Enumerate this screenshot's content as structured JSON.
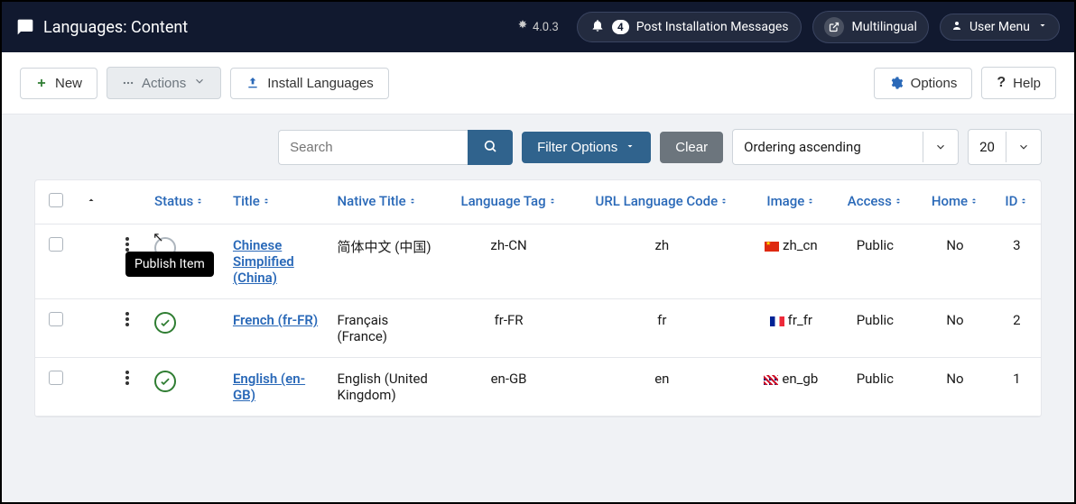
{
  "topbar": {
    "title": "Languages: Content",
    "version": "4.0.3",
    "notif_count": "4",
    "notif_label": "Post Installation Messages",
    "multilingual_label": "Multilingual",
    "user_menu_label": "User Menu"
  },
  "toolbar": {
    "new_label": "New",
    "actions_label": "Actions",
    "install_label": "Install Languages",
    "options_label": "Options",
    "help_label": "Help"
  },
  "filters": {
    "search_placeholder": "Search",
    "filter_options_label": "Filter Options",
    "clear_label": "Clear",
    "ordering_label": "Ordering ascending",
    "page_size": "20"
  },
  "table": {
    "columns": {
      "status": "Status",
      "title": "Title",
      "native_title": "Native Title",
      "language_tag": "Language Tag",
      "url_code": "URL Language Code",
      "image": "Image",
      "access": "Access",
      "home": "Home",
      "id": "ID"
    },
    "rows": [
      {
        "status": "unpublished",
        "title": "Chinese Simplified (China)",
        "native": "简体中文 (中国)",
        "tag": "zh-CN",
        "url": "zh",
        "image": "zh_cn",
        "flag": "cn",
        "access": "Public",
        "home": "No",
        "id": "3"
      },
      {
        "status": "published",
        "title": "French (fr-FR)",
        "native": "Français (France)",
        "tag": "fr-FR",
        "url": "fr",
        "image": "fr_fr",
        "flag": "fr",
        "access": "Public",
        "home": "No",
        "id": "2"
      },
      {
        "status": "published",
        "title": "English (en-GB)",
        "native": "English (United Kingdom)",
        "tag": "en-GB",
        "url": "en",
        "image": "en_gb",
        "flag": "gb",
        "access": "Public",
        "home": "No",
        "id": "1"
      }
    ],
    "tooltip": "Publish Item"
  }
}
